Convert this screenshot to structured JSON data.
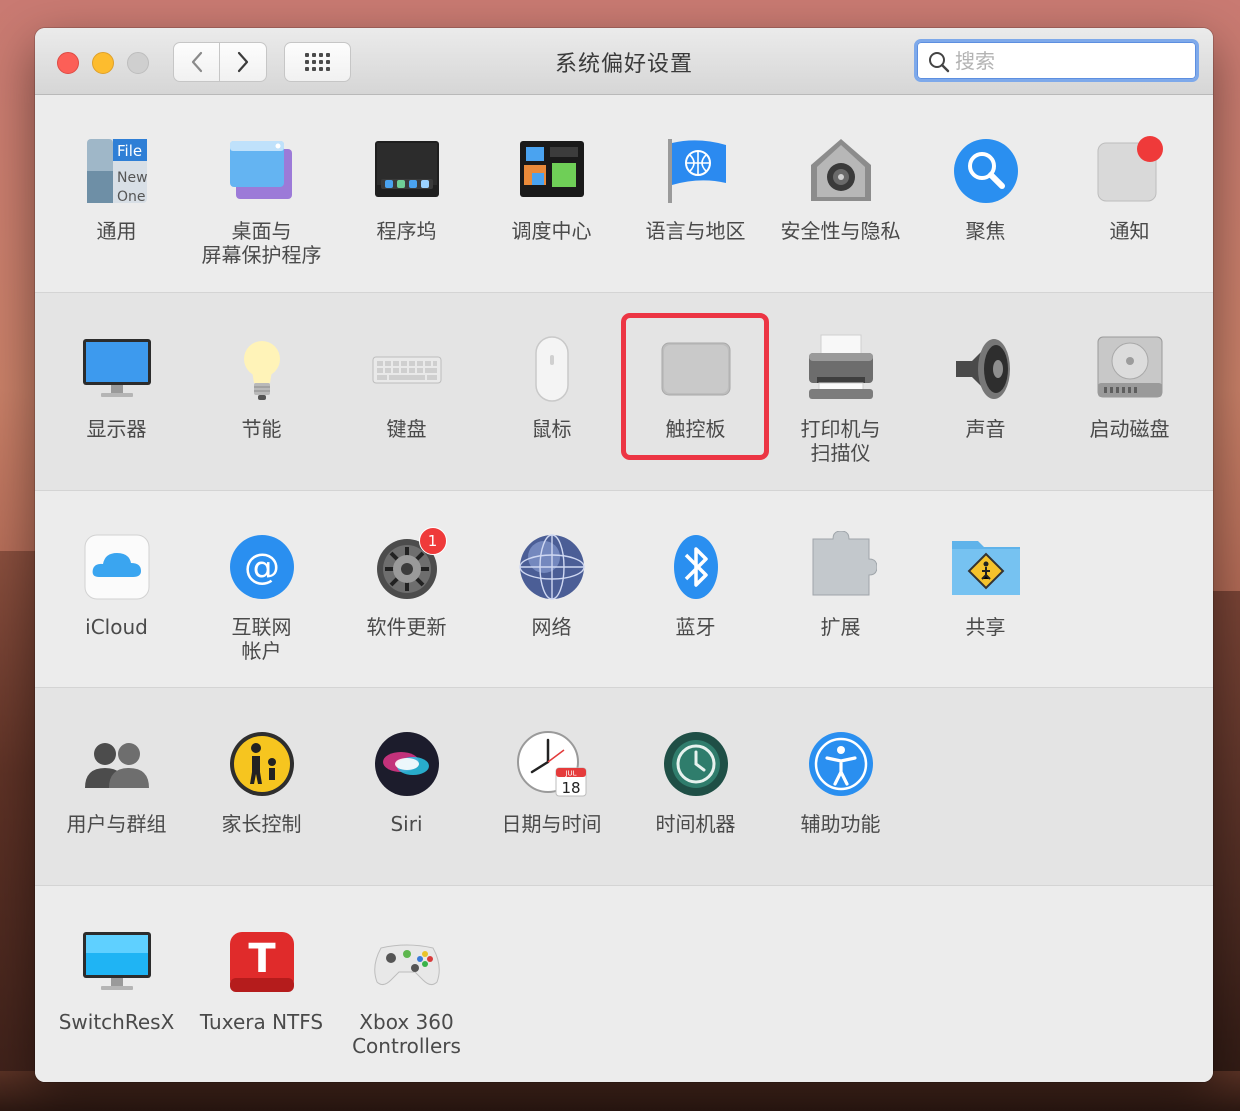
{
  "window": {
    "title": "系统偏好设置",
    "search_placeholder": "搜索"
  },
  "rows": [
    [
      {
        "id": "general",
        "lines": [
          "通用"
        ],
        "icon": "general-icon"
      },
      {
        "id": "desktop",
        "lines": [
          "桌面与",
          "屏幕保护程序"
        ],
        "icon": "desktop-screensaver-icon"
      },
      {
        "id": "dock",
        "lines": [
          "程序坞"
        ],
        "icon": "dock-icon"
      },
      {
        "id": "mission",
        "lines": [
          "调度中心"
        ],
        "icon": "mission-control-icon"
      },
      {
        "id": "language",
        "lines": [
          "语言与地区"
        ],
        "icon": "language-region-icon"
      },
      {
        "id": "security",
        "lines": [
          "安全性与隐私"
        ],
        "icon": "security-privacy-icon"
      },
      {
        "id": "spotlight",
        "lines": [
          "聚焦"
        ],
        "icon": "spotlight-icon"
      },
      {
        "id": "notifications",
        "lines": [
          "通知"
        ],
        "icon": "notifications-icon"
      }
    ],
    [
      {
        "id": "displays",
        "lines": [
          "显示器"
        ],
        "icon": "displays-icon"
      },
      {
        "id": "energy",
        "lines": [
          "节能"
        ],
        "icon": "energy-saver-icon"
      },
      {
        "id": "keyboard",
        "lines": [
          "键盘"
        ],
        "icon": "keyboard-icon"
      },
      {
        "id": "mouse",
        "lines": [
          "鼠标"
        ],
        "icon": "mouse-icon"
      },
      {
        "id": "trackpad",
        "lines": [
          "触控板"
        ],
        "icon": "trackpad-icon"
      },
      {
        "id": "printers",
        "lines": [
          "打印机与",
          "扫描仪"
        ],
        "icon": "printer-scanner-icon"
      },
      {
        "id": "sound",
        "lines": [
          "声音"
        ],
        "icon": "sound-icon"
      },
      {
        "id": "startup",
        "lines": [
          "启动磁盘"
        ],
        "icon": "startup-disk-icon"
      }
    ],
    [
      {
        "id": "icloud",
        "lines": [
          "iCloud"
        ],
        "icon": "icloud-icon"
      },
      {
        "id": "internet",
        "lines": [
          "互联网",
          "帐户"
        ],
        "icon": "internet-accounts-icon"
      },
      {
        "id": "update",
        "lines": [
          "软件更新"
        ],
        "icon": "software-update-icon",
        "badge": "1"
      },
      {
        "id": "network",
        "lines": [
          "网络"
        ],
        "icon": "network-icon"
      },
      {
        "id": "bluetooth",
        "lines": [
          "蓝牙"
        ],
        "icon": "bluetooth-icon"
      },
      {
        "id": "extensions",
        "lines": [
          "扩展"
        ],
        "icon": "extensions-icon"
      },
      {
        "id": "sharing",
        "lines": [
          "共享"
        ],
        "icon": "sharing-icon"
      }
    ],
    [
      {
        "id": "users",
        "lines": [
          "用户与群组"
        ],
        "icon": "users-groups-icon"
      },
      {
        "id": "parental",
        "lines": [
          "家长控制"
        ],
        "icon": "parental-controls-icon"
      },
      {
        "id": "siri",
        "lines": [
          "Siri"
        ],
        "icon": "siri-icon"
      },
      {
        "id": "datetime",
        "lines": [
          "日期与时间"
        ],
        "icon": "date-time-icon"
      },
      {
        "id": "timemachine",
        "lines": [
          "时间机器"
        ],
        "icon": "time-machine-icon"
      },
      {
        "id": "accessibility",
        "lines": [
          "辅助功能"
        ],
        "icon": "accessibility-icon"
      }
    ],
    [
      {
        "id": "switchresx",
        "lines": [
          "SwitchResX"
        ],
        "icon": "switchresx-icon"
      },
      {
        "id": "tuxera",
        "lines": [
          "Tuxera NTFS"
        ],
        "icon": "tuxera-ntfs-icon"
      },
      {
        "id": "xbox",
        "lines": [
          "Xbox 360",
          "Controllers"
        ],
        "icon": "xbox-controller-icon"
      }
    ]
  ],
  "highlighted_pane": "trackpad",
  "icon_text": {
    "general_file": "File",
    "general_new": "New",
    "general_one": "One",
    "calendar_month": "JUL",
    "calendar_day": "18",
    "tuxera_letter": "T",
    "internet_at": "@",
    "update_badge": "1"
  },
  "colors": {
    "highlight": "#ec3544",
    "search_focus": "#7ea9ea"
  }
}
